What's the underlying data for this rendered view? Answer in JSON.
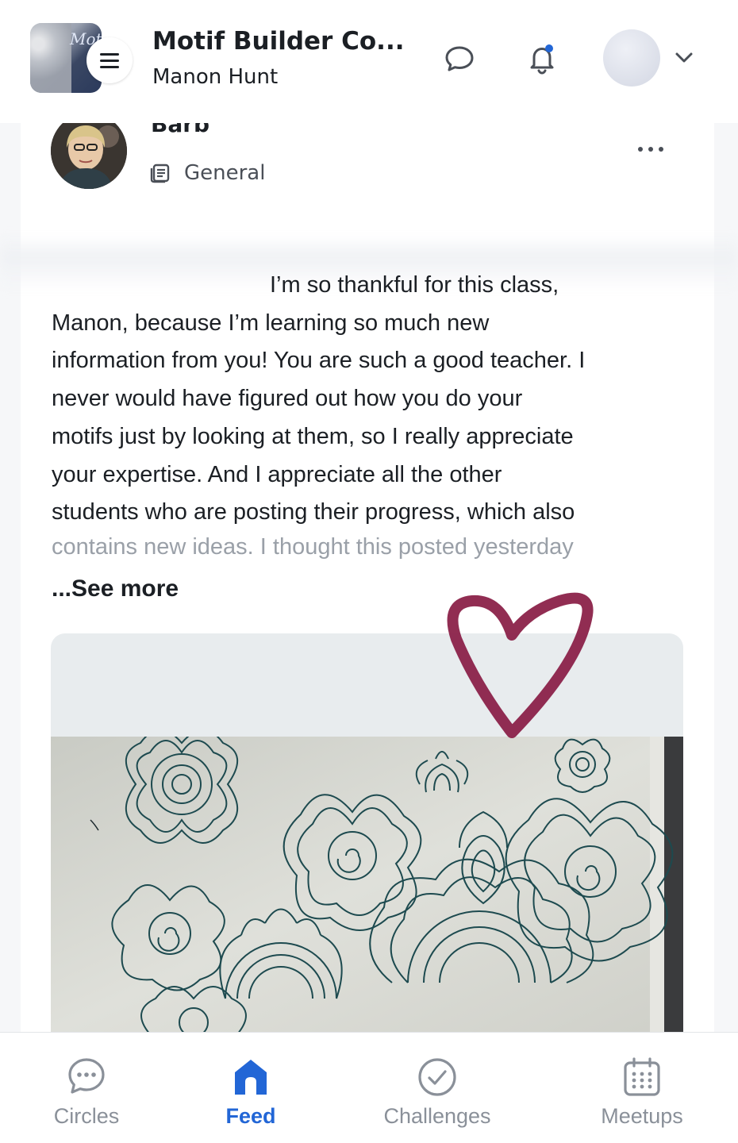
{
  "header": {
    "logo_text": "Motif",
    "title": "Motif Builder Co...",
    "subtitle": "Manon Hunt"
  },
  "post": {
    "author": "Barb",
    "space": "General",
    "body_lines": [
      "I’m so thankful for this class,",
      "Manon, because I’m learning so much new",
      "information from you! You are such a good teacher. I",
      "never would have figured out how you do your",
      "motifs just by looking at them, so I really appreciate",
      "your expertise. And I appreciate all the other",
      "students who are  posting their progress, which also"
    ],
    "faded_line": "contains new ideas. I thought this posted yesterday",
    "see_more": "...See more"
  },
  "bottom_nav": {
    "items": [
      {
        "label": "Circles",
        "icon": "chat-dots-icon",
        "active": false
      },
      {
        "label": "Feed",
        "icon": "home-icon",
        "active": true
      },
      {
        "label": "Challenges",
        "icon": "check-circle-icon",
        "active": false
      },
      {
        "label": "Meetups",
        "icon": "calendar-icon",
        "active": false
      }
    ]
  },
  "colors": {
    "accent": "#2266d6",
    "heart": "#8b2249",
    "thread": "#1d4a4f"
  }
}
